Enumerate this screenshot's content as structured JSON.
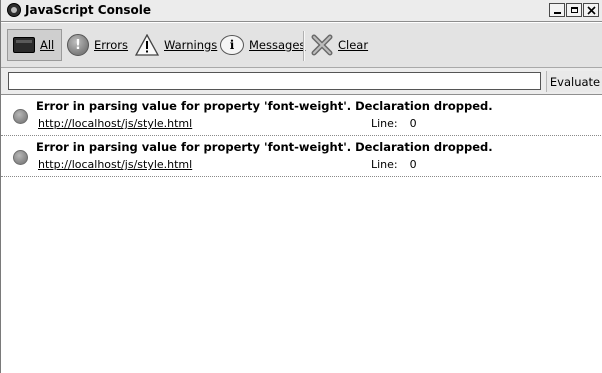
{
  "window": {
    "title": "JavaScript Console"
  },
  "toolbar": {
    "all_label": "All",
    "errors_label": "Errors",
    "warnings_label": "Warnings",
    "messages_label": "Messages",
    "clear_label": "Clear"
  },
  "evaluate": {
    "input_value": "",
    "button_label": "Evaluate"
  },
  "messages": [
    {
      "text": "Error in parsing value for property 'font-weight'.  Declaration dropped.",
      "source": "http://localhost/js/style.html",
      "line_label": "Line:",
      "line_number": "0"
    },
    {
      "text": "Error in parsing value for property 'font-weight'.  Declaration dropped.",
      "source": "http://localhost/js/style.html",
      "line_label": "Line:",
      "line_number": "0"
    }
  ],
  "icons": {
    "app": "firefox-logo-icon",
    "all": "console-monitor-icon",
    "errors": "error-icon",
    "warnings": "warning-triangle-icon",
    "messages": "info-icon",
    "clear": "clear-x-icon"
  }
}
